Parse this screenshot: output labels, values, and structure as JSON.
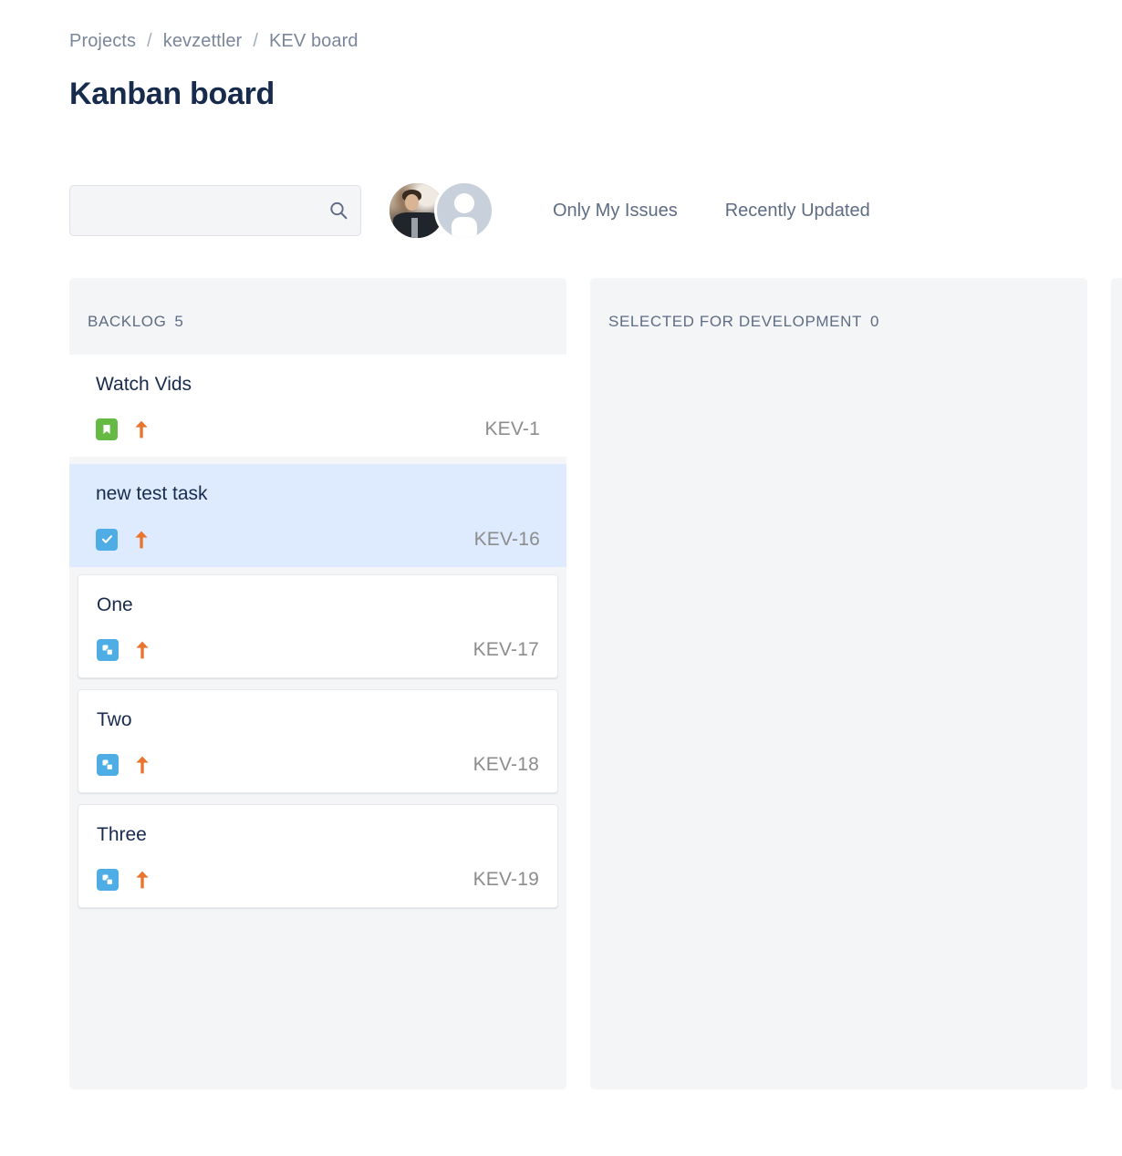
{
  "breadcrumb": {
    "items": [
      "Projects",
      "kevzettler",
      "KEV board"
    ],
    "separator": "/"
  },
  "page_title": "Kanban board",
  "toolbar": {
    "search": {
      "value": "",
      "placeholder": "",
      "icon": "search-icon"
    },
    "avatars": [
      {
        "name": "user-photo-avatar",
        "type": "photo"
      },
      {
        "name": "user-default-avatar",
        "type": "placeholder"
      }
    ],
    "filters": [
      {
        "label": "Only My Issues",
        "active": false
      },
      {
        "label": "Recently Updated",
        "active": false
      }
    ]
  },
  "colors": {
    "page_bg": "#FFFFFF",
    "column_bg": "#F4F5F7",
    "card_bg": "#FFFFFF",
    "card_selected_bg": "#DEEBFF",
    "title_text": "#172B4D",
    "muted_text": "#5E6C84",
    "breadcrumb_text": "#7A869A",
    "key_text": "#8C8C8C",
    "story_green": "#65BA43",
    "task_blue": "#4FADE6",
    "subtask_blue": "#4FADE6",
    "priority_orange": "#E9742E"
  },
  "board": {
    "columns": [
      {
        "id": "backlog",
        "title": "BACKLOG",
        "count": "5",
        "partial": false,
        "cards": [
          {
            "title": "Watch Vids",
            "key": "KEV-1",
            "type": "story",
            "type_icon": "story-bookmark-icon",
            "priority": "high",
            "priority_icon": "arrow-up-icon",
            "selected": false,
            "style": "flush"
          },
          {
            "title": "new test task",
            "key": "KEV-16",
            "type": "task",
            "type_icon": "task-check-icon",
            "priority": "high",
            "priority_icon": "arrow-up-icon",
            "selected": true,
            "style": "selected"
          },
          {
            "title": "One",
            "key": "KEV-17",
            "type": "subtask",
            "type_icon": "subtask-icon",
            "priority": "high",
            "priority_icon": "arrow-up-icon",
            "selected": false,
            "style": "boxed"
          },
          {
            "title": "Two",
            "key": "KEV-18",
            "type": "subtask",
            "type_icon": "subtask-icon",
            "priority": "high",
            "priority_icon": "arrow-up-icon",
            "selected": false,
            "style": "boxed"
          },
          {
            "title": "Three",
            "key": "KEV-19",
            "type": "subtask",
            "type_icon": "subtask-icon",
            "priority": "high",
            "priority_icon": "arrow-up-icon",
            "selected": false,
            "style": "boxed"
          }
        ]
      },
      {
        "id": "selected-for-development",
        "title": "SELECTED FOR DEVELOPMENT",
        "count": "0",
        "partial": false,
        "cards": []
      },
      {
        "id": "third-column-cutoff",
        "title": "",
        "count": "",
        "partial": true,
        "cards": []
      }
    ]
  }
}
